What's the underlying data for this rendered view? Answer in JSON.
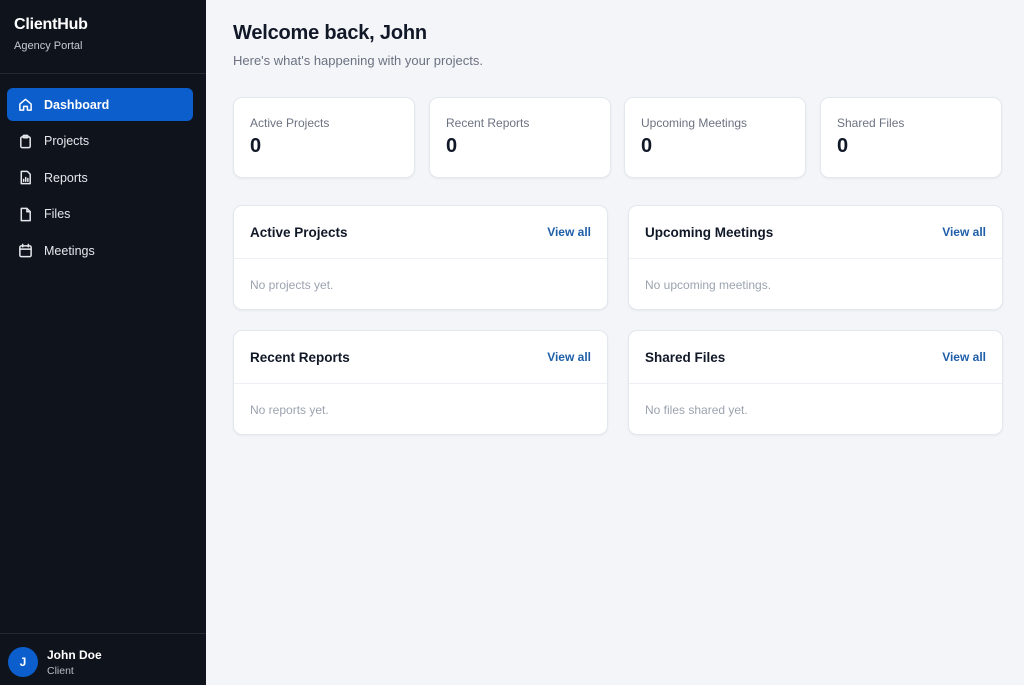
{
  "sidebar": {
    "brand_title": "ClientHub",
    "brand_subtitle": "Agency Portal",
    "items": [
      {
        "label": "Dashboard",
        "icon": "home-icon",
        "active": true
      },
      {
        "label": "Projects",
        "icon": "clipboard-icon",
        "active": false
      },
      {
        "label": "Reports",
        "icon": "report-icon",
        "active": false
      },
      {
        "label": "Files",
        "icon": "file-icon",
        "active": false
      },
      {
        "label": "Meetings",
        "icon": "calendar-icon",
        "active": false
      }
    ],
    "user": {
      "initial": "J",
      "name": "John Doe",
      "role": "Client"
    }
  },
  "header": {
    "title": "Welcome back, John",
    "subtitle": "Here's what's happening with your projects."
  },
  "stats": [
    {
      "label": "Active Projects",
      "value": "0"
    },
    {
      "label": "Recent Reports",
      "value": "0"
    },
    {
      "label": "Upcoming Meetings",
      "value": "0"
    },
    {
      "label": "Shared Files",
      "value": "0"
    }
  ],
  "panels": [
    {
      "title": "Active Projects",
      "link": "View all",
      "empty": "No projects yet."
    },
    {
      "title": "Upcoming Meetings",
      "link": "View all",
      "empty": "No upcoming meetings."
    },
    {
      "title": "Recent Reports",
      "link": "View all",
      "empty": "No reports yet."
    },
    {
      "title": "Shared Files",
      "link": "View all",
      "empty": "No files shared yet."
    }
  ],
  "colors": {
    "sidebar_bg": "#0f141c",
    "accent": "#0b5ecb",
    "link": "#1f5fa8",
    "page_bg": "#f3f5f9"
  }
}
